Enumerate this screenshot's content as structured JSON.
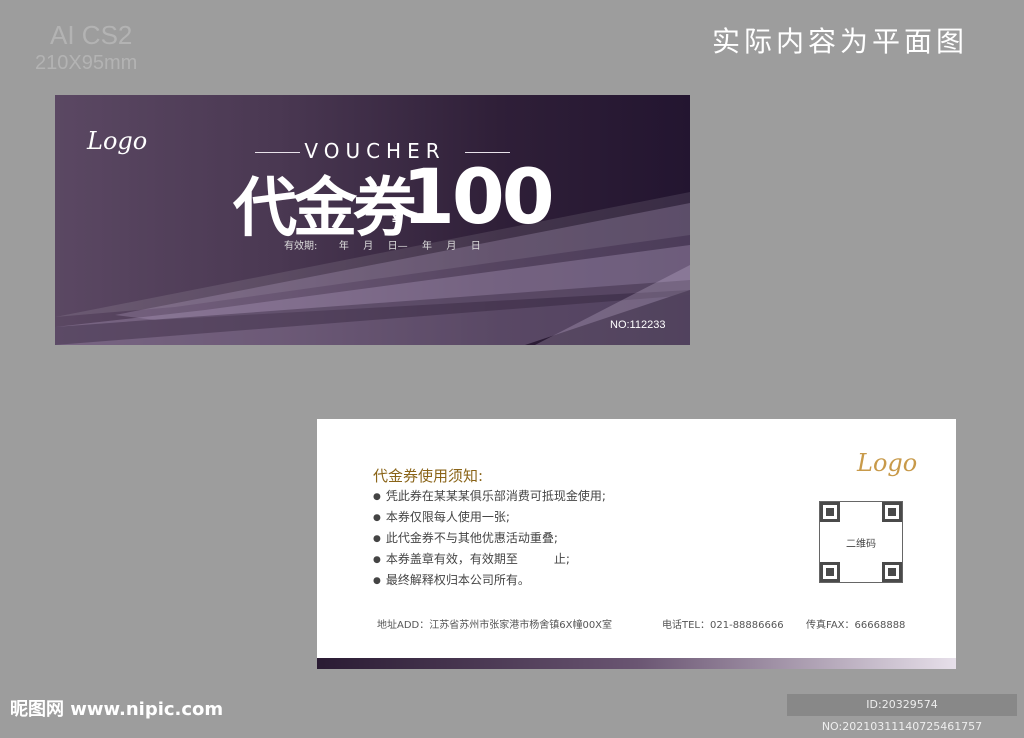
{
  "spec": {
    "software": "AI CS2",
    "size": "210X95mm"
  },
  "note": "实际内容为平面图",
  "front": {
    "logo": "Logo",
    "voucher": "VOUCHER",
    "title": "代金券",
    "currency": "¥",
    "amount": "100",
    "validity": "有效期:   年  月  日—  年  月  日",
    "number": "NO:112233"
  },
  "back": {
    "logo": "Logo",
    "notice_title": "代金券使用须知:",
    "rules": [
      "凭此券在某某某俱乐部消费可抵现金使用;",
      "本券仅限每人使用一张;",
      "此代金券不与其他优惠活动重叠;",
      "本券盖章有效，有效期至　　　止;",
      "最终解释权归本公司所有。"
    ],
    "qr_label": "二维码",
    "address": "地址ADD：江苏省苏州市张家港市杨舍镇6X幢00X室",
    "tel": "电话TEL：021-88886666",
    "fax": "传真FAX：66668888"
  },
  "watermark": "昵图网 www.nipic.com",
  "image_id": "ID:20329574 NO:20210311140725461757",
  "colors": {
    "bg": "#9d9d9d",
    "front_dark": "#2f1f38",
    "gold": "#8a6418"
  }
}
